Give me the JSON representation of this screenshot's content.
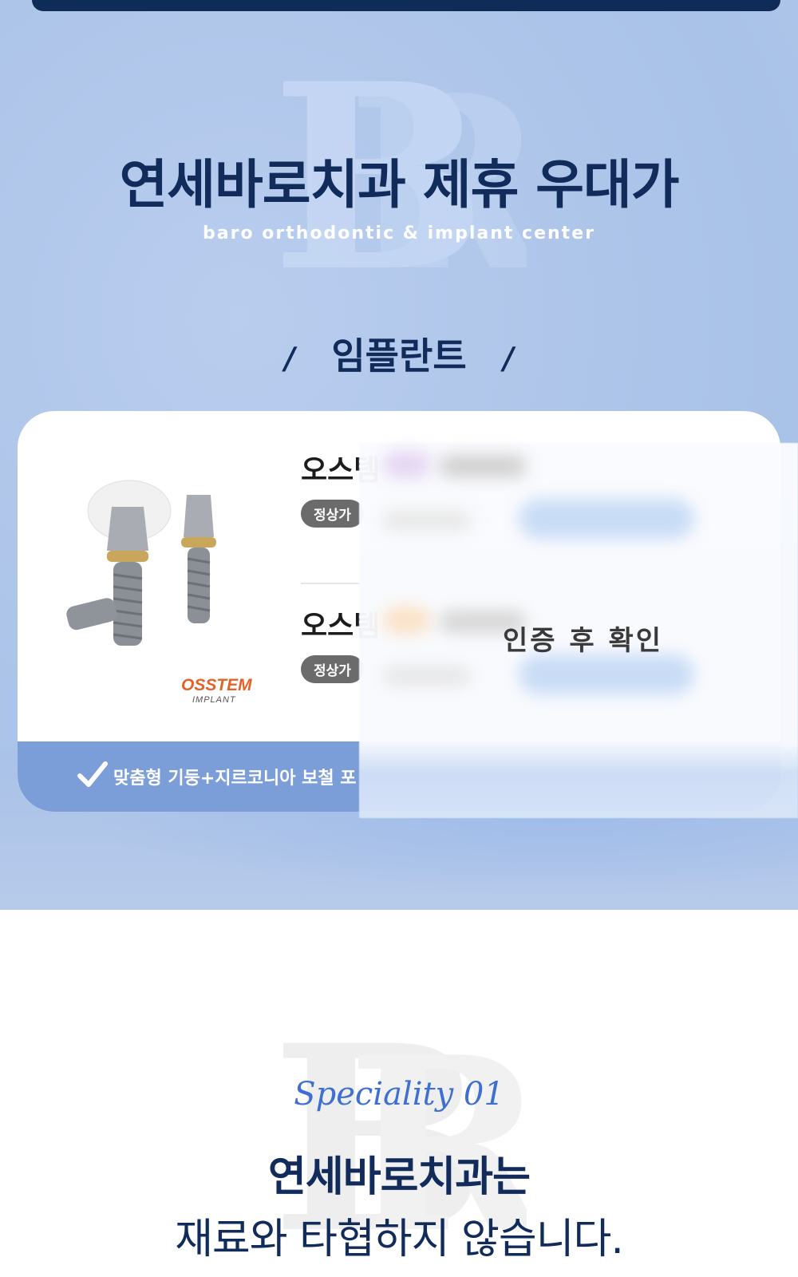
{
  "hero": {
    "title": "연세바로치과 제휴 우대가",
    "subtitle": "baro orthodontic & implant center",
    "monogram": "B"
  },
  "section": {
    "slash": "/",
    "label": "임플란트"
  },
  "card": {
    "rows": [
      {
        "name": "오스템",
        "badge": "정상가"
      },
      {
        "name": "오스템",
        "badge": "정상가"
      }
    ],
    "brand_logo": "OSSTEM IMPLANT",
    "footer_text": "맞춤형 기둥+지르코니아 보철 포",
    "overlay_text": "인증 후 확인"
  },
  "speciality": {
    "script": "Speciality 01",
    "title_line1": "연세바로치과는",
    "title_line2": "재료와 타협하지 않습니다."
  },
  "colors": {
    "navy": "#112b5a",
    "accent_blue": "#7c9ed8",
    "script_blue": "#3f6fcf"
  },
  "icons": [
    "check-icon",
    "implant-product-image",
    "monogram-logo"
  ]
}
